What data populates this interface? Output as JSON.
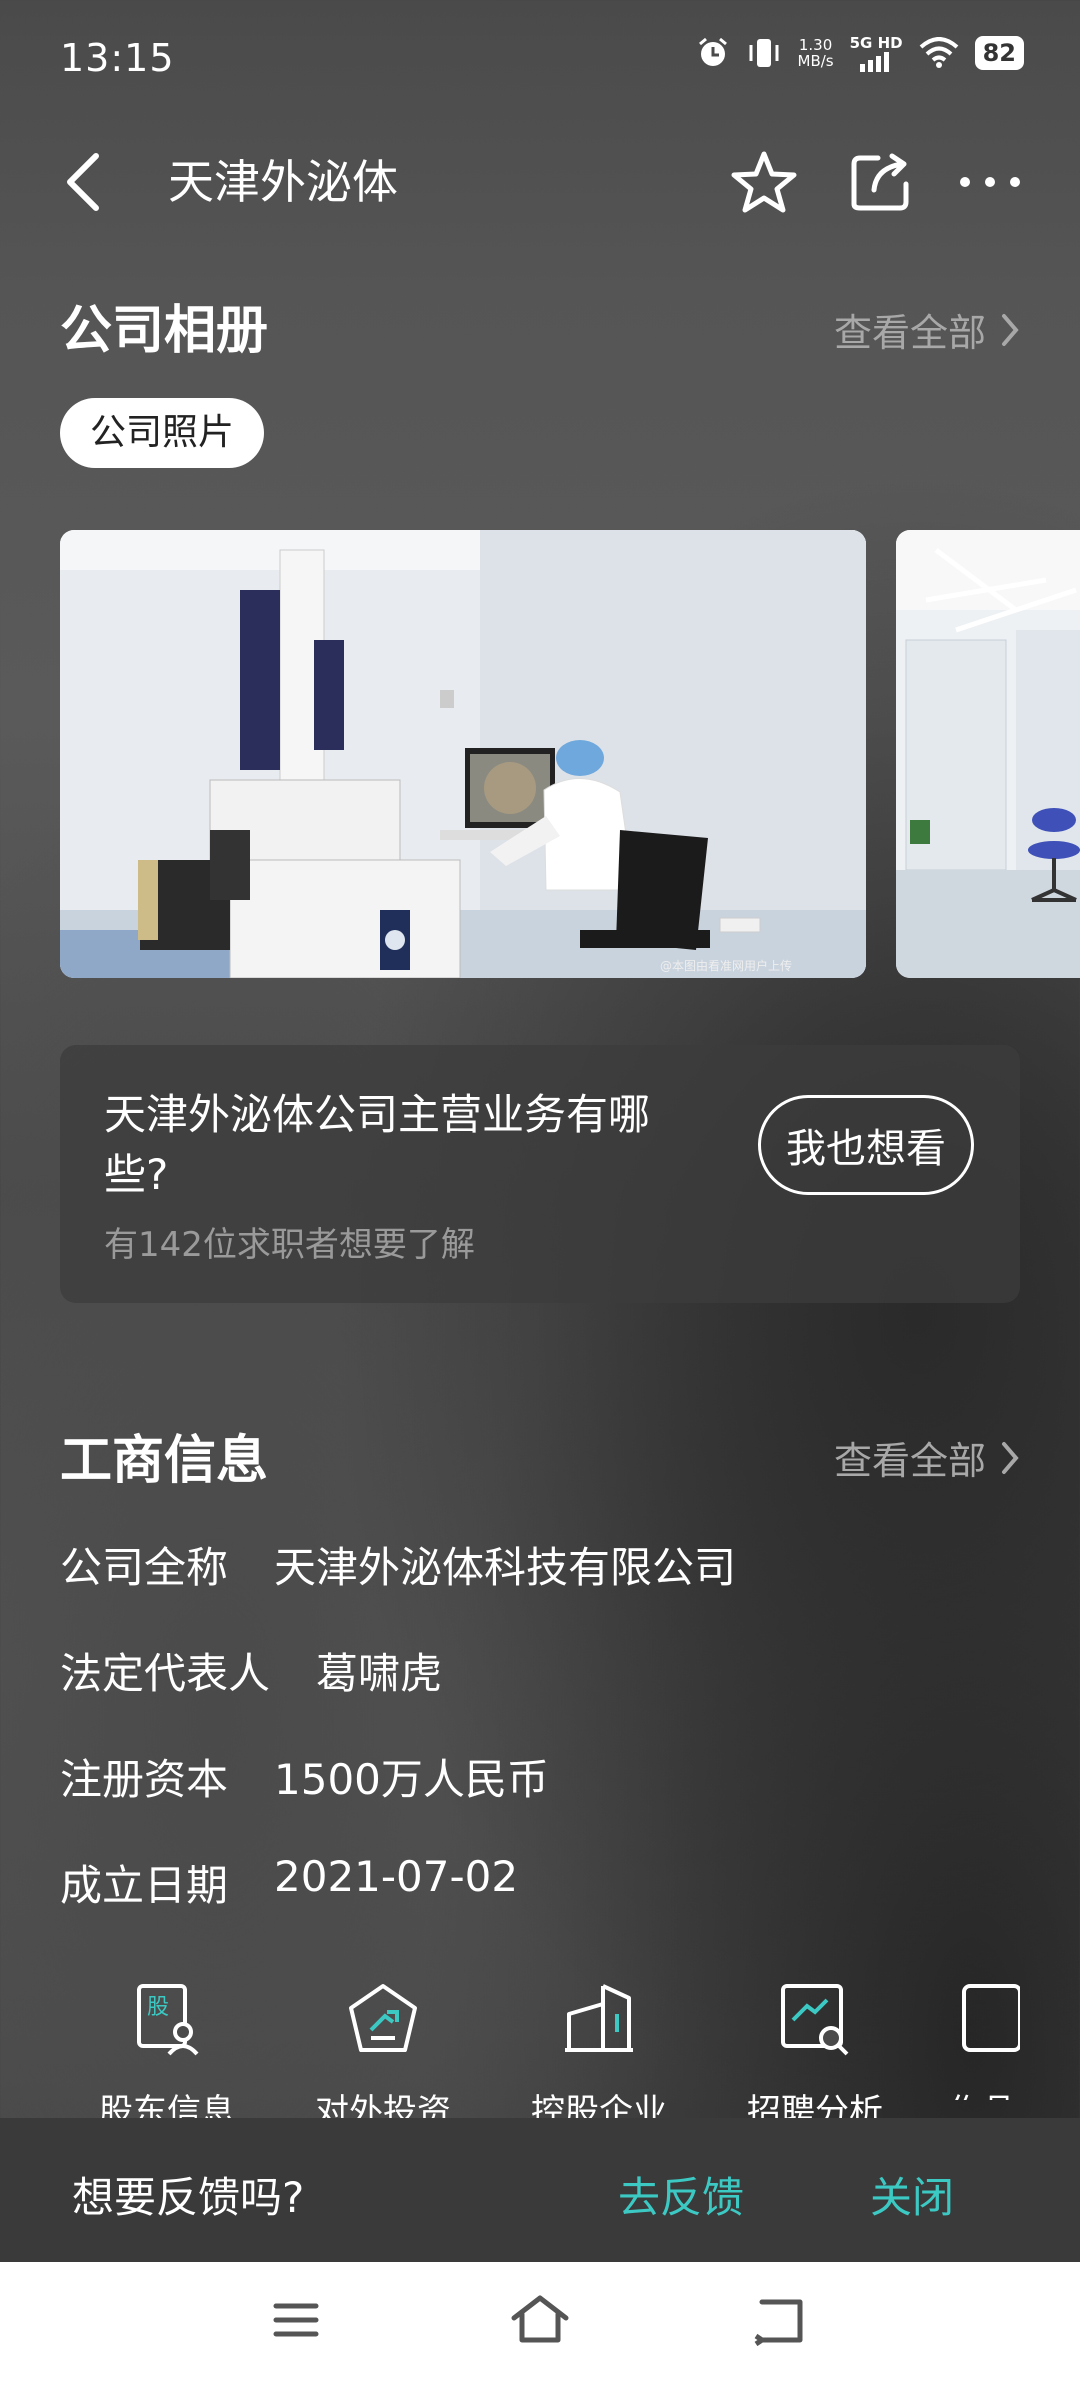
{
  "status_bar": {
    "time": "13:15",
    "net_speed_value": "1.30",
    "net_speed_unit": "MB/s",
    "network": "5G HD",
    "battery": "82"
  },
  "header": {
    "title": "天津外泌体",
    "icons": [
      "back-icon",
      "star-icon",
      "share-icon",
      "more-icon"
    ]
  },
  "album": {
    "title": "公司相册",
    "see_all": "查看全部",
    "tab": "公司照片",
    "watermark": "@本图由看准网用户上传"
  },
  "question": {
    "text": "天津外泌体公司主营业务有哪些?",
    "sub": "有142位求职者想要了解",
    "button": "我也想看"
  },
  "business": {
    "title": "工商信息",
    "see_all": "查看全部",
    "rows": [
      {
        "key": "公司全称",
        "value": "天津外泌体科技有限公司"
      },
      {
        "key": "法定代表人",
        "value": "葛啸虎"
      },
      {
        "key": "注册资本",
        "value": "1500万人民币"
      },
      {
        "key": "成立日期",
        "value": "2021-07-02"
      }
    ]
  },
  "quick_links": [
    {
      "label": "股东信息",
      "icon": "shareholder-icon",
      "glyph": "股"
    },
    {
      "label": "对外投资",
      "icon": "investment-icon"
    },
    {
      "label": "控股企业",
      "icon": "holding-company-icon"
    },
    {
      "label": "招聘分析",
      "icon": "recruitment-analysis-icon"
    },
    {
      "label": "作品集",
      "icon": "portfolio-icon"
    }
  ],
  "feedback": {
    "prompt": "想要反馈吗?",
    "go": "去反馈",
    "close": "关闭"
  },
  "colors": {
    "accent": "#3cc9c4",
    "muted": "#a8a8a8"
  }
}
